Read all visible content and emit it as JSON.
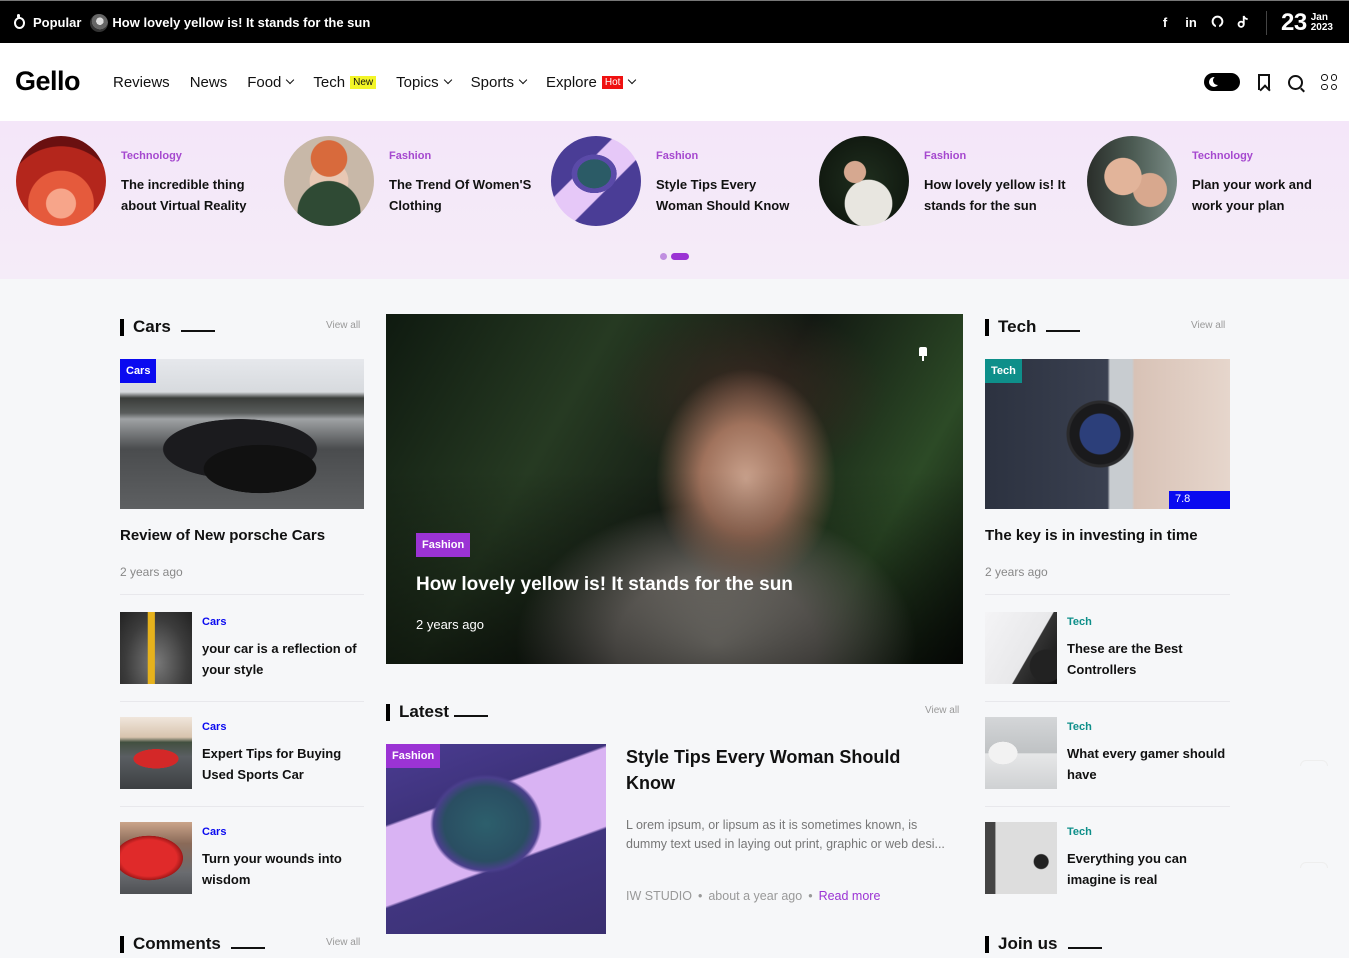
{
  "topbar": {
    "popular_label": "Popular",
    "popular_headline": "How lovely yellow is! It stands for the sun",
    "social": [
      {
        "icon": "facebook-icon",
        "glyph": "f"
      },
      {
        "icon": "linkedin-icon",
        "glyph": "in"
      },
      {
        "icon": "github-icon",
        "glyph": "❁"
      },
      {
        "icon": "tiktok-icon",
        "glyph": "♪"
      }
    ],
    "date": {
      "day": "23",
      "month": "Jan",
      "year": "2023"
    }
  },
  "nav": {
    "logo": "Gello",
    "items": [
      {
        "label": "Reviews",
        "dropdown": false
      },
      {
        "label": "News",
        "dropdown": false
      },
      {
        "label": "Food",
        "dropdown": true
      },
      {
        "label": "Tech",
        "dropdown": false,
        "badge": "New"
      },
      {
        "label": "Topics",
        "dropdown": true
      },
      {
        "label": "Sports",
        "dropdown": true
      },
      {
        "label": "Explore",
        "dropdown": true,
        "badge": "Hot"
      }
    ],
    "icons": [
      "dark-mode-toggle",
      "bookmark-icon",
      "search-icon",
      "apps-grid-icon"
    ]
  },
  "slider": {
    "items": [
      {
        "category": "Technology",
        "title": "The incredible thing about Virtual Reality"
      },
      {
        "category": "Fashion",
        "title": "The Trend Of Women'S Clothing"
      },
      {
        "category": "Fashion",
        "title": "Style Tips Every Woman Should Know"
      },
      {
        "category": "Fashion",
        "title": "How lovely yellow is! It stands for the sun"
      },
      {
        "category": "Technology",
        "title": "Plan your work and work your plan"
      }
    ],
    "pages": 2,
    "active_page": 2
  },
  "cars": {
    "title": "Cars",
    "view_all": "View all",
    "featured": {
      "tag": "Cars",
      "title": "Review of New porsche Cars",
      "time": "2 years ago"
    },
    "items": [
      {
        "category": "Cars",
        "title": "your car is a reflection of your style"
      },
      {
        "category": "Cars",
        "title": "Expert Tips for Buying Used Sports Car"
      },
      {
        "category": "Cars",
        "title": "Turn your wounds into wisdom"
      }
    ]
  },
  "comments": {
    "title": "Comments",
    "view_all": "View all"
  },
  "hero": {
    "tag": "Fashion",
    "title": "How lovely yellow is! It stands for the sun",
    "time": "2 years ago"
  },
  "latest": {
    "title": "Latest",
    "view_all": "View all",
    "article": {
      "tag": "Fashion",
      "title": "Style Tips Every Woman Should Know",
      "excerpt": "L orem ipsum, or lipsum as it is sometimes known, is dummy text used in laying out print, graphic or web desi...",
      "author": "IW STUDIO",
      "time": "about a year ago",
      "read_more": "Read more"
    }
  },
  "tech": {
    "title": "Tech",
    "view_all": "View all",
    "featured": {
      "tag": "Tech",
      "score": "7.8",
      "title": "The key is in investing in time",
      "time": "2 years ago"
    },
    "items": [
      {
        "category": "Tech",
        "title": "These are the Best Controllers"
      },
      {
        "category": "Tech",
        "title": "What every gamer should have"
      },
      {
        "category": "Tech",
        "title": "Everything you can imagine is real"
      }
    ]
  },
  "join": {
    "title": "Join us"
  },
  "colors": {
    "accent_purple": "#9b33d4",
    "cars_blue": "#0a0af0",
    "tech_teal": "#0e8f8a",
    "new_badge": "#f3f527",
    "hot_badge": "#ef1010"
  }
}
